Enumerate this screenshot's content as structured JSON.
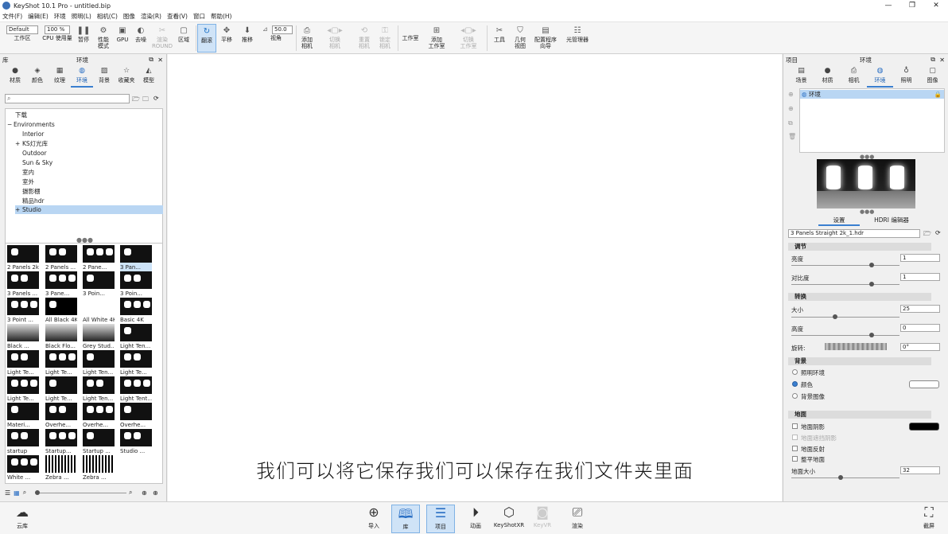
{
  "window": {
    "title": "KeyShot 10.1 Pro  - untitled.bip"
  },
  "menu": [
    "文件(F)",
    "编辑(E)",
    "环境",
    "照明(L)",
    "相机(C)",
    "图像",
    "渲染(R)",
    "查看(V)",
    "窗口",
    "帮助(H)"
  ],
  "toolbar": {
    "preset_select": "Default",
    "zoom_select": "100 %",
    "fov_value": "50.0",
    "buttons": [
      {
        "label": "工作区"
      },
      {
        "label": "CPU 使用量"
      },
      {
        "label": "暂停"
      },
      {
        "label": "性能\n模式"
      },
      {
        "label": "GPU"
      },
      {
        "label": "去噪"
      },
      {
        "label": "渲染\nROUND"
      },
      {
        "label": "区域"
      },
      {
        "label": "翻滚"
      },
      {
        "label": "平移"
      },
      {
        "label": "推移"
      },
      {
        "label": "视角"
      },
      {
        "label": "添加\n相机"
      },
      {
        "label": "切换\n相机"
      },
      {
        "label": "重置\n相机"
      },
      {
        "label": "锁定\n相机"
      },
      {
        "label": "工作室"
      },
      {
        "label": "添加\n工作室"
      },
      {
        "label": "切换\n工作室"
      },
      {
        "label": "工具"
      },
      {
        "label": "几何\n视图"
      },
      {
        "label": "配置程序\n向导"
      },
      {
        "label": "光管理器"
      }
    ]
  },
  "library": {
    "panel_label": "库",
    "title": "环境",
    "tabs": [
      "材质",
      "颜色",
      "纹理",
      "环境",
      "背景",
      "收藏夹",
      "模型"
    ],
    "selected_tab": "环境",
    "search_placeholder": "",
    "tree": [
      {
        "label": "下载",
        "indent": 0
      },
      {
        "label": "Environments",
        "indent": 0,
        "toggle": "−"
      },
      {
        "label": "Interior",
        "indent": 1
      },
      {
        "label": "KS灯光库",
        "indent": 1,
        "toggle": "+"
      },
      {
        "label": "Outdoor",
        "indent": 1
      },
      {
        "label": "Sun & Sky",
        "indent": 1
      },
      {
        "label": "室内",
        "indent": 1
      },
      {
        "label": "室外",
        "indent": 1
      },
      {
        "label": "摄影棚",
        "indent": 1
      },
      {
        "label": "精品hdr",
        "indent": 1
      },
      {
        "label": "Studio",
        "indent": 1,
        "toggle": "+",
        "selected": true
      }
    ],
    "thumbnails": [
      "2 Panels 2k",
      "2 Panels ...",
      "2 Pane...",
      "3 Pan...",
      "3 Panels ...",
      "3 Pane...",
      "3 Poin...",
      "3 Poin...",
      "3 Point ...",
      "All Black 4K",
      "All White 4K",
      "Basic 4K",
      "Black ...",
      "Black Flo...",
      "Grey Stud...",
      "Light Ten...",
      "Light Te...",
      "Light Te...",
      "Light Ten...",
      "Light Te...",
      "Light Te...",
      "Light Te...",
      "Light Ten...",
      "Light Tent...",
      "Materi...",
      "Overhe...",
      "Overhe...",
      "Overhe...",
      "startup",
      "Startup...",
      "Startup ...",
      "Studio ...",
      "White ...",
      "Zebra ...",
      "Zebra ..."
    ]
  },
  "viewport": {
    "subtitle": "我们可以将它保存我们可以保存在我们文件夹里面"
  },
  "project": {
    "panel_label": "项目",
    "title": "环境",
    "tabs": [
      "场景",
      "材质",
      "相机",
      "环境",
      "照明",
      "图像"
    ],
    "selected_tab": "环境",
    "env_list_item": "环境",
    "subtabs": [
      "设置",
      "HDRI 编辑器"
    ],
    "hdr_file": "3 Panels Straight 2k_1.hdr",
    "sections": {
      "adjust": "调节",
      "transform": "转换",
      "background": "背景",
      "ground": "地面"
    },
    "brightness": {
      "label": "亮度",
      "value": "1",
      "level": 0.75
    },
    "contrast": {
      "label": "对比度",
      "value": "1",
      "level": 0.75
    },
    "size": {
      "label": "大小",
      "value": "25",
      "level": 0.4
    },
    "height": {
      "label": "高度",
      "value": "0",
      "level": 0.75
    },
    "rotation": {
      "label": "旋转:",
      "value": "0°"
    },
    "background_options": [
      "照明环境",
      "颜色",
      "背景图像"
    ],
    "background_selected": "颜色",
    "ground_options": [
      {
        "label": "地面阴影",
        "disabled": false
      },
      {
        "label": "地面遮挡阴影",
        "disabled": true
      },
      {
        "label": "地面反射",
        "disabled": false
      },
      {
        "label": "整平地面",
        "disabled": false
      }
    ],
    "ground_size": {
      "label": "地面大小",
      "value": "32",
      "level": 0.45
    }
  },
  "bottombar": {
    "left_label": "云库",
    "buttons": [
      "导入",
      "库",
      "项目",
      "动画",
      "KeyShotXR",
      "KeyVR",
      "渲染"
    ],
    "right_label": "截屏"
  }
}
